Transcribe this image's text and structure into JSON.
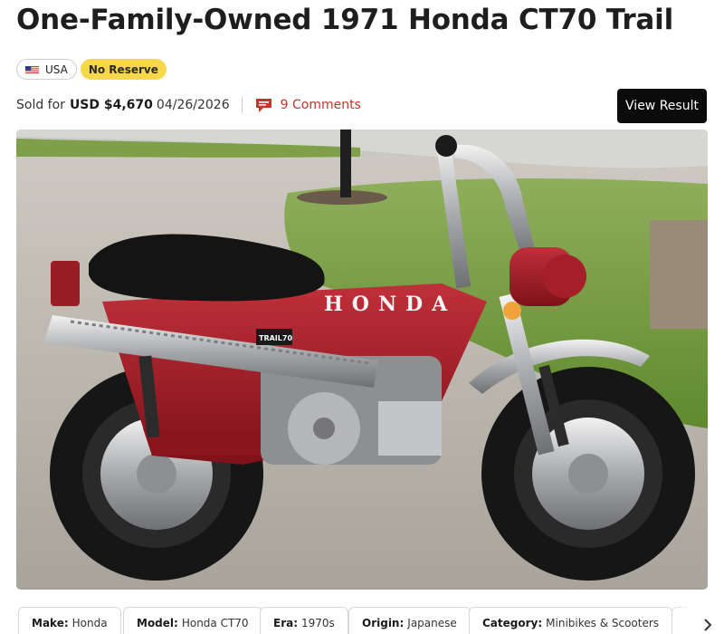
{
  "listing": {
    "title": "One-Family-Owned 1971 Honda CT70 Trail",
    "country_badge": "USA",
    "reserve_badge": "No Reserve",
    "sold_label": "Sold for",
    "sold_price": "USD $4,670",
    "sold_date": "04/26/2026",
    "comments_label": "9 Comments",
    "view_result_label": "View Result"
  },
  "photo": {
    "fuel_tank_text": "HONDA",
    "side_badge_text": "TRAIL70"
  },
  "specs": [
    {
      "key": "Make:",
      "value": "Honda"
    },
    {
      "key": "Model:",
      "value": "Honda CT70"
    },
    {
      "key": "Era:",
      "value": "1970s"
    },
    {
      "key": "Origin:",
      "value": "Japanese"
    },
    {
      "key": "Category:",
      "value": "Minibikes & Scooters"
    }
  ],
  "icons": {
    "flag": "us-flag-icon",
    "comments": "comment-bubble-icon",
    "next": "chevron-right-icon"
  },
  "colors": {
    "accent_red": "#c8332a",
    "reserve_yellow": "#f8d74a",
    "button_black": "#0b0b0b",
    "bike_red": "#9a1d24"
  }
}
